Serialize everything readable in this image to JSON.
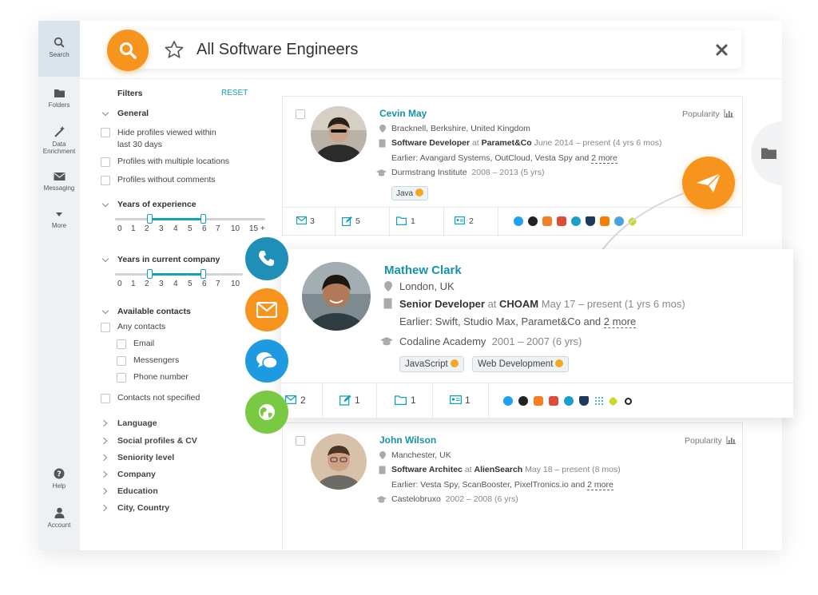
{
  "nav": {
    "search": "Search",
    "folders": "Folders",
    "data_enrichment_line1": "Data",
    "data_enrichment_line2": "Enrichment",
    "messaging": "Messaging",
    "more": "More",
    "help": "Help",
    "account": "Account"
  },
  "search": {
    "query": "All Software Engineers"
  },
  "filters": {
    "title": "Filters",
    "reset": "RESET",
    "general": {
      "label": "General",
      "opt1_line1": "Hide profiles viewed within",
      "opt1_line2": "last 30 days",
      "opt2": "Profiles with multiple locations",
      "opt3": "Profiles without comments"
    },
    "experience": {
      "label": "Years of experience",
      "ticks": [
        "0",
        "1",
        "2",
        "3",
        "4",
        "5",
        "6",
        "7",
        "10",
        "15 +"
      ]
    },
    "company_years": {
      "label": "Years in current company",
      "ticks": [
        "0",
        "1",
        "2",
        "3",
        "4",
        "5",
        "6",
        "7",
        "10"
      ]
    },
    "contacts": {
      "label": "Available contacts",
      "any": "Any contacts",
      "email": "Email",
      "messengers": "Messengers",
      "phone": "Phone number",
      "not_specified": "Contacts not specified"
    },
    "collapsed": [
      "Language",
      "Social profiles & CV",
      "Seniority level",
      "Company",
      "Education",
      "City, Country"
    ]
  },
  "cards": [
    {
      "name": "Cevin May",
      "popularity": "Popularity",
      "location": "Bracknell, Berkshire, United Kingdom",
      "role": "Software Developer",
      "at": "at",
      "company": "Paramet&Co",
      "period": "June 2014 – present (4 yrs 6 mos)",
      "earlier": "Earlier: Avangard Systems, OutCloud, Vesta Spy and",
      "more": "2 more",
      "school": "Durmstrang Institute",
      "school_period": "2008 – 2013 (5 yrs)",
      "tags": [
        "Java"
      ],
      "stats": [
        "3",
        "5",
        "1",
        "2"
      ]
    },
    {
      "name": "Mathew Clark",
      "location": "London, UK",
      "role": "Senior Developer",
      "at": "at",
      "company": "CHOAM",
      "period": "May 17 – present (1 yrs 6 mos)",
      "earlier": "Earlier: Swift, Studio Max, Paramet&Co and",
      "more": "2 more",
      "school": "Codaline Academy",
      "school_period": "2001 – 2007 (6 yrs)",
      "tags": [
        "JavaScript",
        "Web Development"
      ],
      "stats": [
        "2",
        "1",
        "1",
        "1"
      ]
    },
    {
      "name": "John Wilson",
      "popularity": "Popularity",
      "location": "Manchester, UK",
      "role": "Software Architec",
      "at": "at",
      "company": "AlienSearch",
      "period": "May 18 – present (8 mos)",
      "earlier": "Earlier: Vesta Spy, ScanBooster, PixelTronics.io and",
      "more": "2 more",
      "school": "Castelobruxo",
      "school_period": "2002 – 2008 (6 yrs)"
    }
  ],
  "colors": {
    "accent": "#15a0b9",
    "orange": "#f7941d",
    "phone": "#1f8fb8",
    "messenger": "#1e9ae0",
    "globe": "#7ac943"
  }
}
